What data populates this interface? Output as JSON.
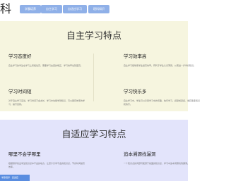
{
  "header": {
    "logo_text": "科",
    "nav": [
      {
        "label": "学霸培养"
      },
      {
        "label": "自主学习"
      },
      {
        "label": "自适应学习"
      },
      {
        "label": "理科知识"
      }
    ]
  },
  "section_self": {
    "title": "自主学习特点",
    "features": [
      {
        "title": "学习态度好",
        "desc": "自主学习的学生在学习上积极性高，需要学习态度的端正，学习效率也就更高。"
      },
      {
        "title": "学习效率高",
        "desc": "自主学习能够使学生提高效率，有利于学生认识薄弱，从而进一步学好知识。"
      },
      {
        "title": "学习时间短",
        "desc": "对于自主学习来说，学习时间不会太长，学习中也能学到知识，可以更有效率的学习，提升自我。"
      },
      {
        "title": "学习快乐多",
        "desc": "自主学习中，学生可以享受学习中的乐趣，快乐学习，感受成就感，收获更多知识和快乐。"
      }
    ]
  },
  "section_adaptive": {
    "title": "自适应学习特点",
    "features": [
      {
        "title": "哪里不会学哪里",
        "desc": "根据测评找出学生知识点中不会的地方，让孩子只学不会的知识点，节省时间提高效率。"
      },
      {
        "title": "追本溯源找漏洞",
        "desc": "一个知识点的问题可能源于前面的知识点，学习中追本溯源找到漏洞。"
      }
    ]
  },
  "overlay": {
    "text": "学霸培养 · 自适应"
  }
}
